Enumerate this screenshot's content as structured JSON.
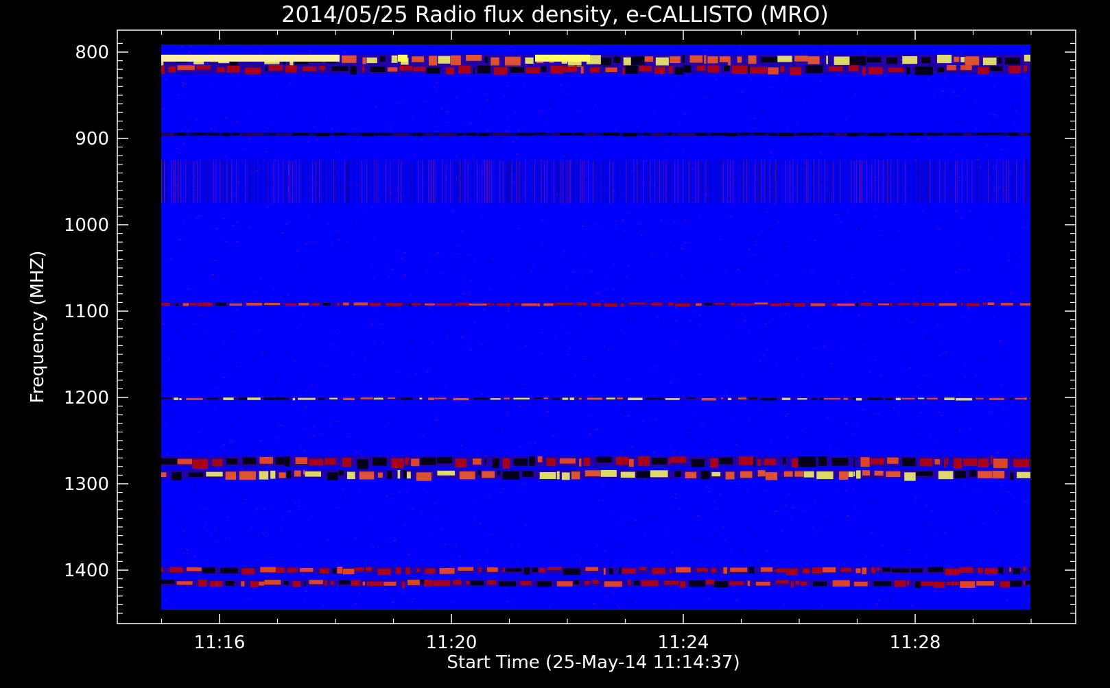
{
  "chart_data": {
    "type": "heatmap",
    "title": "2014/05/25  Radio flux density, e-CALLISTO (MRO)",
    "xlabel": "Start Time (25-May-14 11:14:37)",
    "ylabel": "Frequency (MHZ)",
    "x_range": [
      "11:14:37",
      "11:30:00"
    ],
    "xlim_minutes": [
      14.6,
      30.0
    ],
    "ylim": [
      790,
      1450
    ],
    "y_axis_inverted": true,
    "x_ticks": [
      "11:16",
      "11:20",
      "11:24",
      "11:28"
    ],
    "x_tick_minutes": [
      16,
      20,
      24,
      28
    ],
    "y_ticks": [
      800,
      900,
      1000,
      1100,
      1200,
      1300,
      1400
    ],
    "y_tick_labels": [
      "800",
      "900",
      "1000",
      "1100",
      "1200",
      "1300",
      "1400"
    ],
    "colors": {
      "background": "#0000ff",
      "low": "#000000",
      "mid": "#c00000",
      "high": "#ffff60",
      "axes": "#ffffff",
      "page": "#000000"
    },
    "features": [
      {
        "name": "bright band",
        "freq_start": 803,
        "freq_end": 815,
        "intensity": "high"
      },
      {
        "name": "red band",
        "freq_start": 815,
        "freq_end": 825,
        "intensity": "mid"
      },
      {
        "name": "dark line",
        "freq_start": 893,
        "freq_end": 897,
        "intensity": "low"
      },
      {
        "name": "striped region",
        "freq_start": 925,
        "freq_end": 975,
        "intensity": "mid"
      },
      {
        "name": "faint line",
        "freq_start": 1090,
        "freq_end": 1094,
        "intensity": "mid"
      },
      {
        "name": "narrow line",
        "freq_start": 1200,
        "freq_end": 1203,
        "intensity": "high"
      },
      {
        "name": "band",
        "freq_start": 1268,
        "freq_end": 1280,
        "intensity": "mid"
      },
      {
        "name": "band",
        "freq_start": 1284,
        "freq_end": 1294,
        "intensity": "high"
      },
      {
        "name": "band",
        "freq_start": 1396,
        "freq_end": 1404,
        "intensity": "mid"
      },
      {
        "name": "band",
        "freq_start": 1411,
        "freq_end": 1419,
        "intensity": "mid"
      }
    ]
  }
}
